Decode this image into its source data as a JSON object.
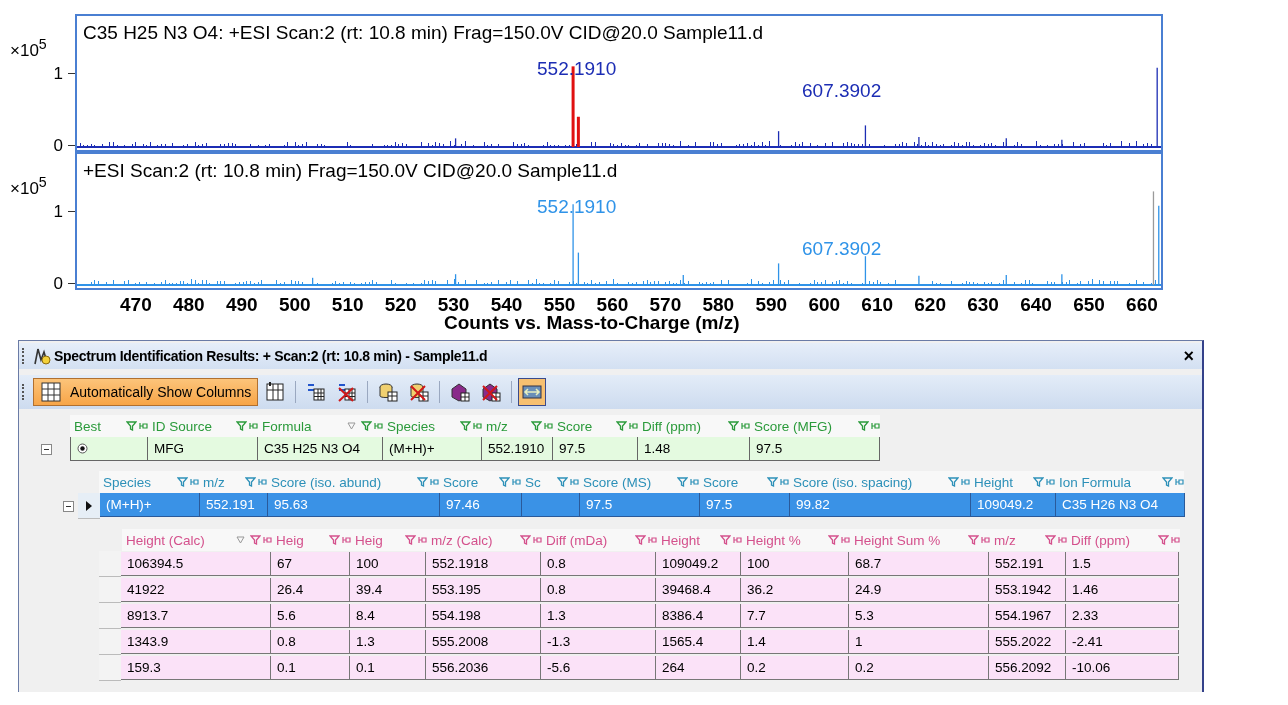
{
  "spectra": [
    {
      "title": "C35 H25 N3 O4: +ESI Scan:2 (rt: 10.8 min) Frag=150.0V CID@20.0 Sample11.d",
      "scale": "×10$^{5}$",
      "y_ticks": [
        "1",
        "0"
      ],
      "peak_labels": [
        "552.1910",
        "607.3902"
      ],
      "color": "#1c2db4",
      "highlight": true
    },
    {
      "title": "+ESI Scan:2 (rt: 10.8 min) Frag=150.0V CID@20.0 Sample11.d",
      "scale": "×10$^{5}$",
      "y_ticks": [
        "1",
        "0"
      ],
      "peak_labels": [
        "552.1910",
        "607.3902"
      ],
      "color": "#2f93e8",
      "highlight": false
    }
  ],
  "x_ticks": [
    "470",
    "480",
    "490",
    "500",
    "510",
    "520",
    "530",
    "540",
    "550",
    "560",
    "570",
    "580",
    "590",
    "600",
    "610",
    "620",
    "630",
    "640",
    "650",
    "660"
  ],
  "x_label": "Counts vs. Mass-to-Charge (m/z)",
  "window": {
    "title": "Spectrum Identification Results: + Scan:2 (rt: 10.8 min) - Sample11.d",
    "close": "×"
  },
  "toolbar": {
    "auto_button": {
      "label": "Automatically Show Columns",
      "on": true
    },
    "buttons": [
      {
        "kind": "columns",
        "on": false
      },
      {
        "kind": "formula-add",
        "on": false
      },
      {
        "kind": "formula-remove",
        "on": false
      },
      {
        "kind": "db-add",
        "on": false
      },
      {
        "kind": "db-remove",
        "on": false
      },
      {
        "kind": "mol-add",
        "on": false
      },
      {
        "kind": "mol-remove",
        "on": false
      },
      {
        "kind": "link",
        "on": true
      }
    ]
  },
  "formula_table": {
    "columns": [
      {
        "label": "Best",
        "sorted": false
      },
      {
        "label": "ID Source",
        "sorted": false
      },
      {
        "label": "Formula",
        "sorted": true
      },
      {
        "label": "Species",
        "sorted": false
      },
      {
        "label": "m/z",
        "sorted": false
      },
      {
        "label": "Score",
        "sorted": false
      },
      {
        "label": "Diff (ppm)",
        "sorted": false
      },
      {
        "label": "Score (MFG)",
        "sorted": false
      }
    ],
    "rows": [
      {
        "expanded": true,
        "best": true,
        "cells": [
          "",
          "MFG",
          "C35 H25 N3 O4",
          "(M+H)+",
          "552.1910",
          "97.5",
          "1.48",
          "97.5"
        ]
      }
    ]
  },
  "species_table": {
    "columns": [
      {
        "label": "Species",
        "sorted": false
      },
      {
        "label": "m/z",
        "sorted": false
      },
      {
        "label": "Score (iso. abund)",
        "sorted": false
      },
      {
        "label": "Score",
        "sorted": false
      },
      {
        "label": "Sc",
        "sorted": false
      },
      {
        "label": "Score (MS)",
        "sorted": false
      },
      {
        "label": "Score",
        "sorted": false
      },
      {
        "label": "Score (iso. spacing)",
        "sorted": false
      },
      {
        "label": "Height",
        "sorted": false
      },
      {
        "label": "Ion Formula",
        "sorted": false
      }
    ],
    "rows": [
      {
        "expanded": true,
        "selected": true,
        "cells": [
          "(M+H)+",
          "552.191",
          "95.63",
          "97.46",
          null,
          "97.5",
          "97.5",
          "99.82",
          "109049.2",
          "C35 H26 N3 O4"
        ]
      }
    ]
  },
  "isotope_table": {
    "columns": [
      {
        "label": "Height (Calc)",
        "sorted": true
      },
      {
        "label": "Heig",
        "sorted": false
      },
      {
        "label": "Heig",
        "sorted": false
      },
      {
        "label": "m/z (Calc)",
        "sorted": false
      },
      {
        "label": "Diff (mDa)",
        "sorted": false
      },
      {
        "label": "Height",
        "sorted": false
      },
      {
        "label": "Height %",
        "sorted": false
      },
      {
        "label": "Height Sum %",
        "sorted": false
      },
      {
        "label": "m/z",
        "sorted": false
      },
      {
        "label": "Diff (ppm)",
        "sorted": false
      }
    ],
    "rows": [
      {
        "cells": [
          "106394.5",
          "67",
          "100",
          "552.1918",
          "0.8",
          "109049.2",
          "100",
          "68.7",
          "552.191",
          "1.5"
        ]
      },
      {
        "cells": [
          "41922",
          "26.4",
          "39.4",
          "553.195",
          "0.8",
          "39468.4",
          "36.2",
          "24.9",
          "553.1942",
          "1.46"
        ]
      },
      {
        "cells": [
          "8913.7",
          "5.6",
          "8.4",
          "554.198",
          "1.3",
          "8386.4",
          "7.7",
          "5.3",
          "554.1967",
          "2.33"
        ]
      },
      {
        "cells": [
          "1343.9",
          "0.8",
          "1.3",
          "555.2008",
          "-1.3",
          "1565.4",
          "1.4",
          "1",
          "555.2022",
          "-2.41"
        ]
      },
      {
        "cells": [
          "159.3",
          "0.1",
          "0.1",
          "556.2036",
          "-5.6",
          "264",
          "0.2",
          "0.2",
          "556.2092",
          "-10.06"
        ]
      }
    ]
  }
}
